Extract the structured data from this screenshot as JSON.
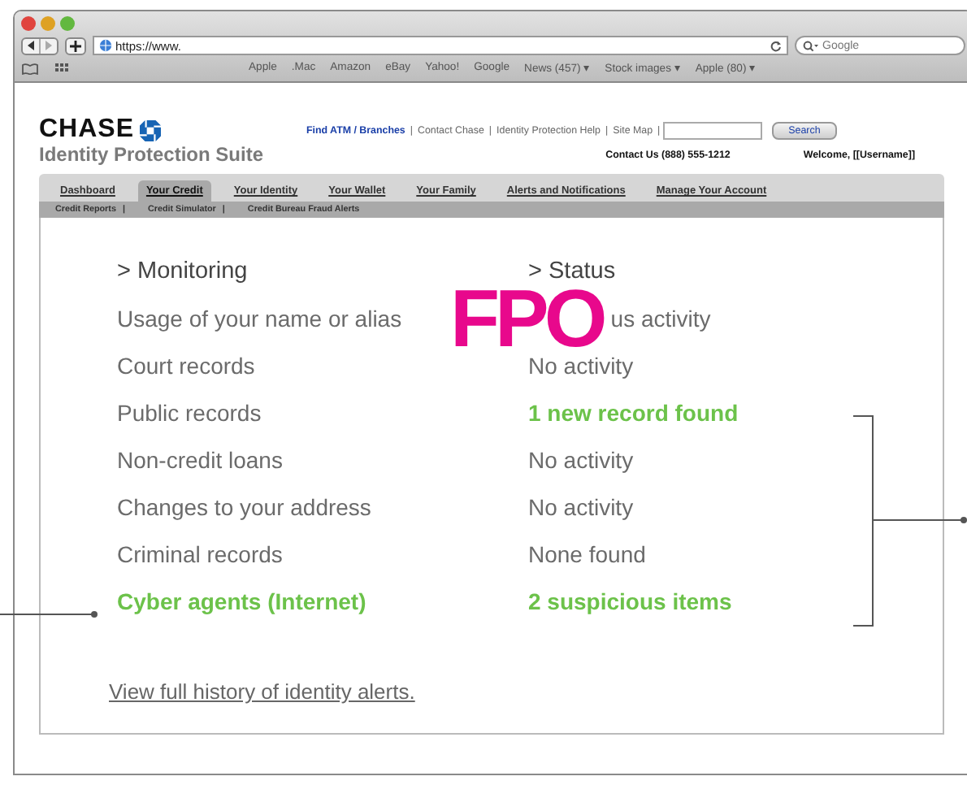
{
  "browser": {
    "url": "https://www.",
    "search_placeholder": "Google",
    "bookmarks": [
      "Apple",
      ".Mac",
      "Amazon",
      "eBay",
      "Yahoo!",
      "Google",
      "News (457) ▾",
      "Stock images ▾",
      "Apple (80) ▾"
    ]
  },
  "header": {
    "logo": "CHASE",
    "suite_title": "Identity Protection Suite",
    "top_links": [
      {
        "label": "Find ATM / Branches",
        "kind": "primary"
      },
      {
        "label": "|",
        "kind": "separator"
      },
      {
        "label": "Contact Chase",
        "kind": "plain"
      },
      {
        "label": "|",
        "kind": "separator"
      },
      {
        "label": "Identity Protection Help",
        "kind": "plain"
      },
      {
        "label": "|",
        "kind": "separator"
      },
      {
        "label": "Site Map",
        "kind": "plain"
      },
      {
        "label": "|",
        "kind": "separator"
      }
    ],
    "search_button": "Search",
    "contact": "Contact Us (888) 555-1212",
    "welcome": "Welcome, [[Username]]"
  },
  "tabs": [
    {
      "label": "Dashboard",
      "selected": false
    },
    {
      "label": "Your Credit",
      "selected": true
    },
    {
      "label": "Your Identity",
      "selected": false
    },
    {
      "label": "Your Wallet",
      "selected": false
    },
    {
      "label": "Your Family",
      "selected": false
    },
    {
      "label": "Alerts and Notifications",
      "selected": false
    },
    {
      "label": "Manage Your Account",
      "selected": false
    }
  ],
  "subtabs": [
    {
      "label": "Credit Reports",
      "kind": "link"
    },
    {
      "label": "|",
      "kind": "separator"
    },
    {
      "label": "Credit Simulator",
      "kind": "link"
    },
    {
      "label": "|",
      "kind": "separator"
    },
    {
      "label": "Credit Bureau Fraud Alerts",
      "kind": "link"
    }
  ],
  "monitoring": {
    "item_heading": "> Monitoring",
    "status_heading": "> Status",
    "rows": [
      {
        "item": {
          "text": "Usage of your name or alias",
          "alert": false
        },
        "status": {
          "text": "us activity",
          "alert": false,
          "overlay": "FPO"
        }
      },
      {
        "item": {
          "text": "Court records",
          "alert": false
        },
        "status": {
          "text": "No activity",
          "alert": false
        }
      },
      {
        "item": {
          "text": "Public records",
          "alert": false
        },
        "status": {
          "text": "1 new record found",
          "alert": true
        }
      },
      {
        "item": {
          "text": "Non-credit loans",
          "alert": false
        },
        "status": {
          "text": "No activity",
          "alert": false
        }
      },
      {
        "item": {
          "text": "Changes to your address",
          "alert": false
        },
        "status": {
          "text": "No activity",
          "alert": false
        }
      },
      {
        "item": {
          "text": "Criminal records",
          "alert": false
        },
        "status": {
          "text": "None found",
          "alert": false
        }
      },
      {
        "item": {
          "text": "Cyber agents (Internet)",
          "alert": true
        },
        "status": {
          "text": "2 suspicious items",
          "alert": true
        }
      }
    ],
    "history_link": "View full history of identity alerts."
  }
}
